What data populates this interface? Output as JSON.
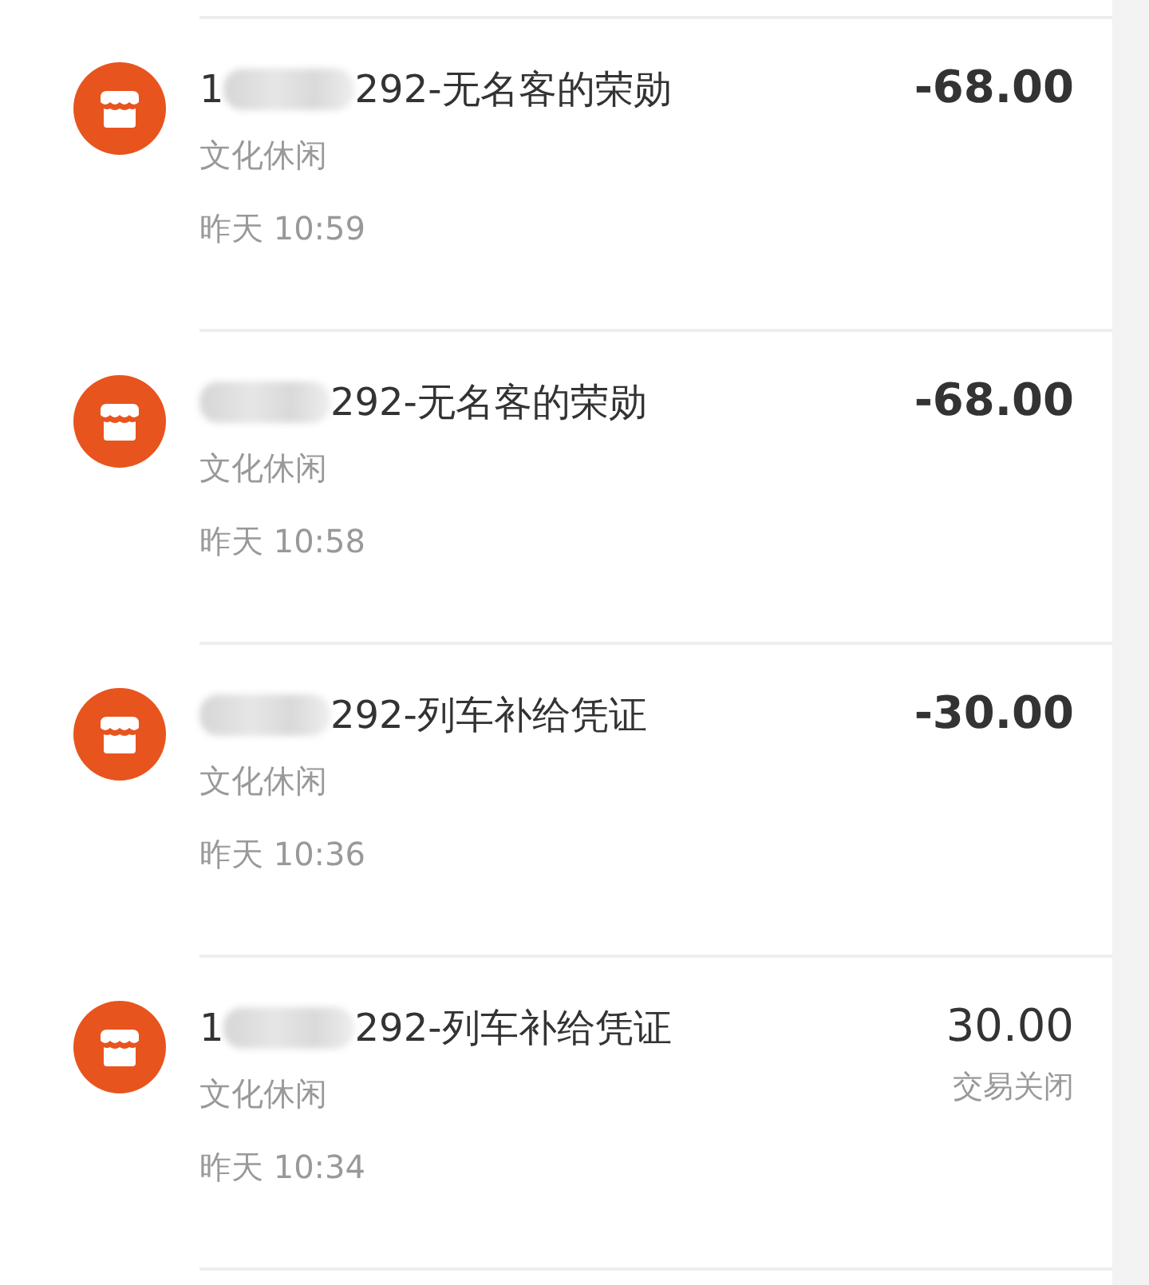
{
  "transactions": [
    {
      "title_prefix": "1",
      "title": "292-无名客的荣勋",
      "category": "文化休闲",
      "time": "昨天 10:59",
      "amount": "-68.00"
    },
    {
      "title": "292-无名客的荣勋",
      "category": "文化休闲",
      "time": "昨天 10:58",
      "amount": "-68.00"
    },
    {
      "title": "292-列车补给凭证",
      "category": "文化休闲",
      "time": "昨天 10:36",
      "amount": "-30.00"
    },
    {
      "title_prefix": "1",
      "title": "292-列车补给凭证",
      "category": "文化休闲",
      "time": "昨天 10:34",
      "amount": "30.00",
      "status": "交易关闭"
    }
  ]
}
